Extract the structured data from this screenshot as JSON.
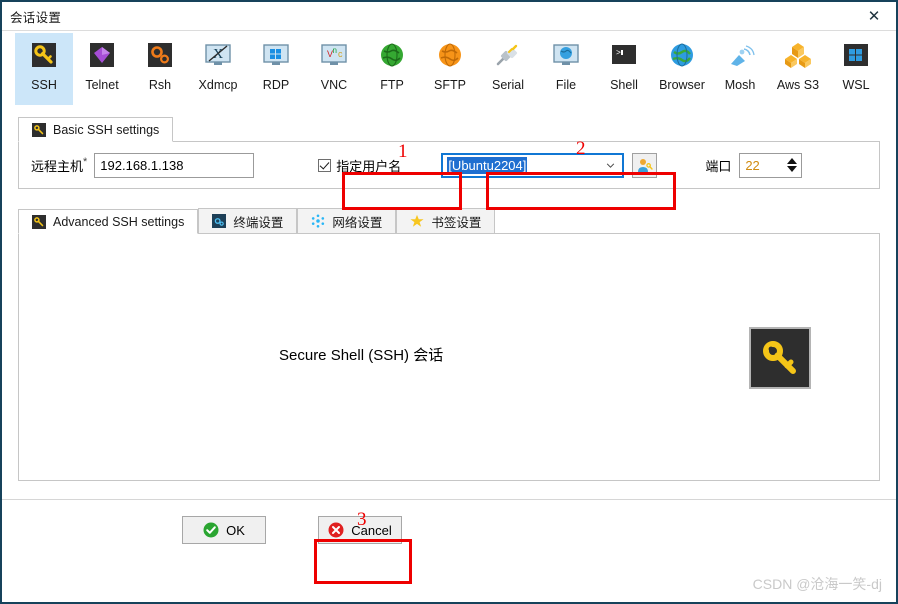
{
  "window": {
    "title": "会话设置",
    "close_label": "✕"
  },
  "protocols": [
    {
      "label": "SSH",
      "icon": "key-icon",
      "selected": true
    },
    {
      "label": "Telnet",
      "icon": "gem-icon",
      "selected": false
    },
    {
      "label": "Rsh",
      "icon": "gears-icon",
      "selected": false
    },
    {
      "label": "Xdmcp",
      "icon": "x-monitor-icon",
      "selected": false
    },
    {
      "label": "RDP",
      "icon": "windows-monitor-icon",
      "selected": false
    },
    {
      "label": "VNC",
      "icon": "vnc-monitor-icon",
      "selected": false
    },
    {
      "label": "FTP",
      "icon": "green-globe-icon",
      "selected": false
    },
    {
      "label": "SFTP",
      "icon": "orange-globe-icon",
      "selected": false
    },
    {
      "label": "Serial",
      "icon": "plug-icon",
      "selected": false
    },
    {
      "label": "File",
      "icon": "file-monitor-icon",
      "selected": false
    },
    {
      "label": "Shell",
      "icon": "terminal-icon",
      "selected": false
    },
    {
      "label": "Browser",
      "icon": "blue-globe-icon",
      "selected": false
    },
    {
      "label": "Mosh",
      "icon": "satellite-icon",
      "selected": false
    },
    {
      "label": "Aws S3",
      "icon": "aws-cubes-icon",
      "selected": false
    },
    {
      "label": "WSL",
      "icon": "windows-icon",
      "selected": false
    }
  ],
  "basic_tab": {
    "label": "Basic SSH settings",
    "icon": "key-icon"
  },
  "basic_form": {
    "host_label": "远程主机",
    "host_required": "*",
    "host_value": "192.168.1.138",
    "host_placeholder": "",
    "specify_user_label": "指定用户名",
    "specify_user_checked": true,
    "username_value": "[Ubuntu2204]",
    "user_button_icon": "user-key-icon",
    "port_label": "端口",
    "port_value": "22"
  },
  "lower_tabs": [
    {
      "label": "Advanced SSH settings",
      "icon": "key-icon",
      "active": true
    },
    {
      "label": "终端设置",
      "icon": "terminal-settings-icon",
      "active": false
    },
    {
      "label": "网络设置",
      "icon": "network-dots-icon",
      "active": false
    },
    {
      "label": "书签设置",
      "icon": "star-icon",
      "active": false
    }
  ],
  "content": {
    "description": "Secure Shell (SSH) 会话",
    "big_icon": "key-icon"
  },
  "buttons": {
    "ok_label": "OK",
    "ok_icon": "green-check-icon",
    "cancel_label": "Cancel",
    "cancel_icon": "red-x-icon"
  },
  "annotations": [
    {
      "number": "1"
    },
    {
      "number": "2"
    },
    {
      "number": "3"
    }
  ],
  "watermark": "CSDN @沧海一笑-dj",
  "colors": {
    "accent": "#1077d4",
    "annotation": "#ee0000",
    "selection": "#cce6f9",
    "border": "#16425b"
  }
}
